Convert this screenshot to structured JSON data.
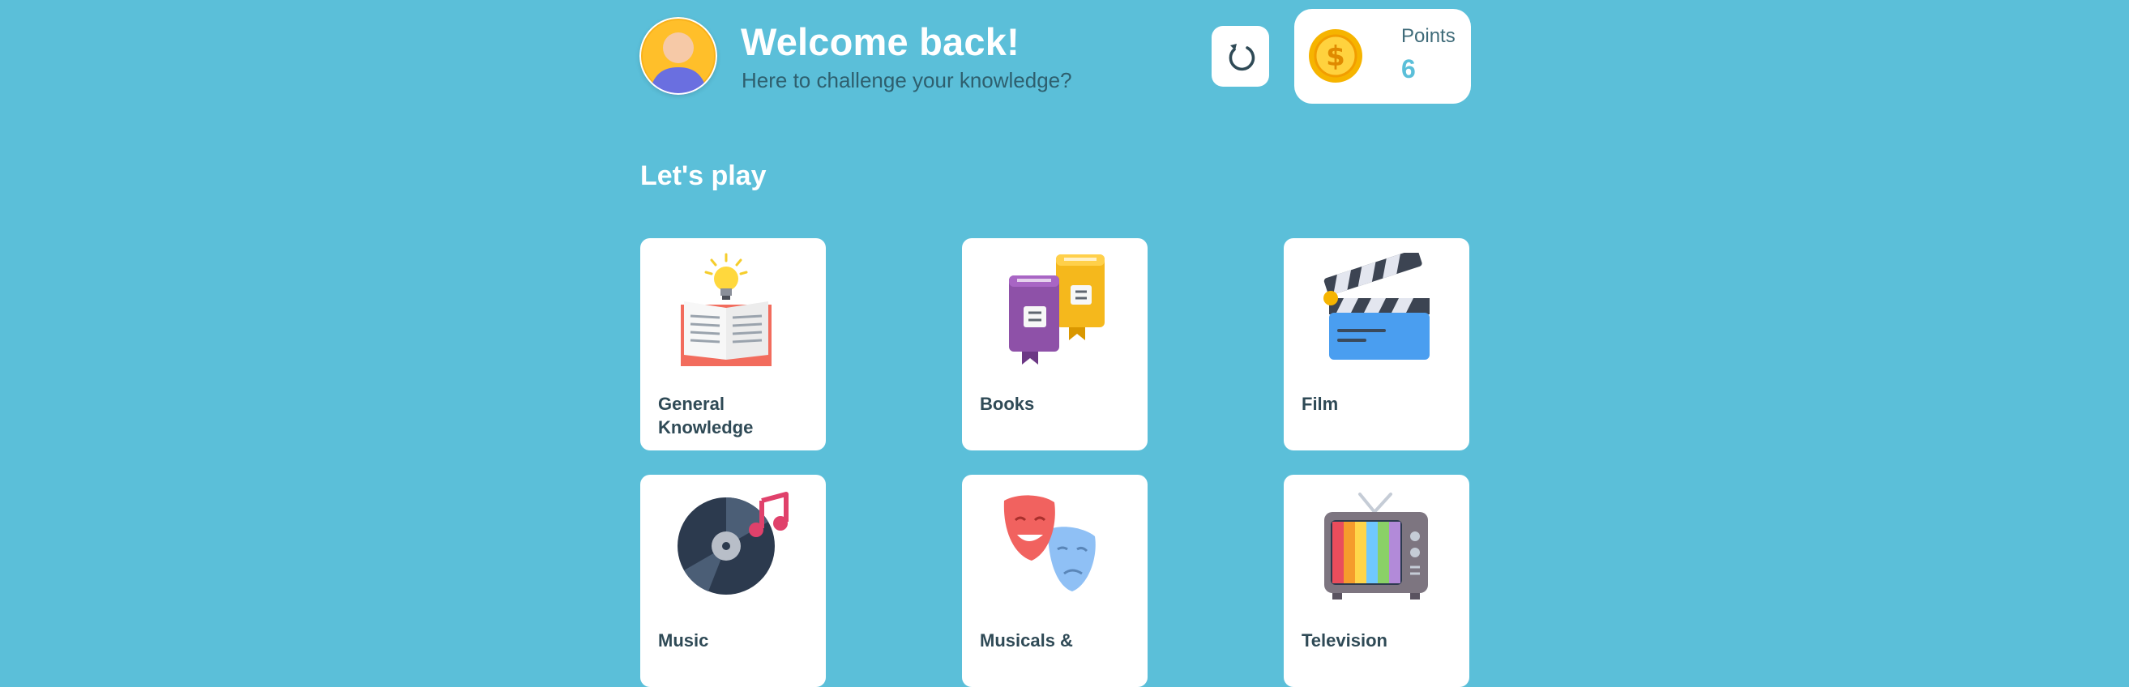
{
  "header": {
    "title": "Welcome back!",
    "subtitle": "Here to challenge your knowledge?",
    "avatar_icon": "user-avatar-icon",
    "refresh_icon": "refresh-icon"
  },
  "points": {
    "label": "Points",
    "value": "6",
    "icon": "coin-icon"
  },
  "section": {
    "title": "Let's play"
  },
  "categories": [
    {
      "label": "General Knowledge",
      "icon": "open-book-lightbulb-icon"
    },
    {
      "label": "Books",
      "icon": "books-icon"
    },
    {
      "label": "Film",
      "icon": "clapperboard-icon"
    },
    {
      "label": "Music",
      "icon": "vinyl-record-icon"
    },
    {
      "label": "Musicals &",
      "icon": "theatre-masks-icon"
    },
    {
      "label": "Television",
      "icon": "television-icon"
    }
  ],
  "colors": {
    "background": "#5bbfd9",
    "card": "#ffffff",
    "text_dark": "#2f4a56",
    "points_value": "#5bbfd9",
    "coin": "#f6b400"
  }
}
